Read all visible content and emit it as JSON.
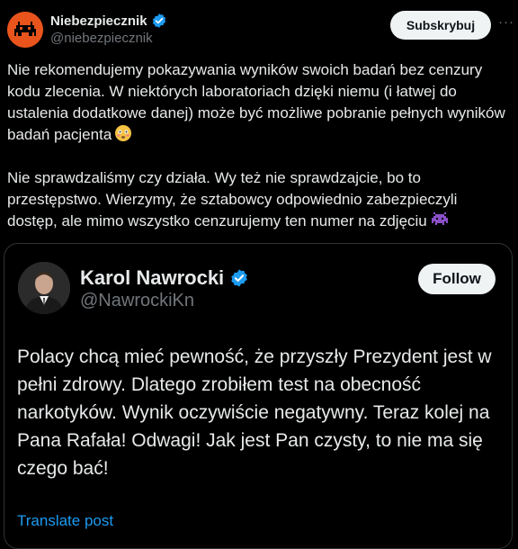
{
  "header": {
    "author_name": "Niebezpiecznik",
    "author_handle": "@niebezpiecznik",
    "subscribe_label": "Subskrybuj",
    "more_label": "···"
  },
  "tweet": {
    "paragraphs": [
      "Nie rekomendujemy pokazywania wyników swoich badań bez cenzury kodu zlecenia. W niektórych laboratoriach dzięki niemu (i łatwej do ustalenia dodatkowe danej) może być możliwe pobranie pełnych wyników badań pacjenta",
      "Nie sprawdzaliśmy czy działa. Wy też nie sprawdzajcie, bo to przestępstwo. Wierzymy, że sztabowcy odpowiednio zabezpieczyli dostęp, ale mimo wszystko cenzurujemy ten numer na zdjęciu"
    ]
  },
  "quote": {
    "author_name": "Karol Nawrocki",
    "author_handle": "@NawrockiKn",
    "follow_label": "Follow",
    "text": "Polacy chcą mieć pewność, że przyszły Prezydent jest w pełni zdrowy. Dlatego zrobiłem test na obecność narkotyków. Wynik oczywiście negatywny. Teraz kolej na Pana Rafała! Odwagi! Jak jest Pan czysty, to nie ma się czego bać!",
    "translate_label": "Translate post"
  },
  "colors": {
    "background": "#000000",
    "text": "#e7e9ea",
    "secondary": "#71767b",
    "link": "#1d9bf0",
    "verified": "#1d9bf0",
    "avatar_accent": "#e8541c"
  },
  "icons": [
    "verified-badge-icon",
    "flushed-face-emoji",
    "alien-monster-emoji",
    "more-icon"
  ]
}
